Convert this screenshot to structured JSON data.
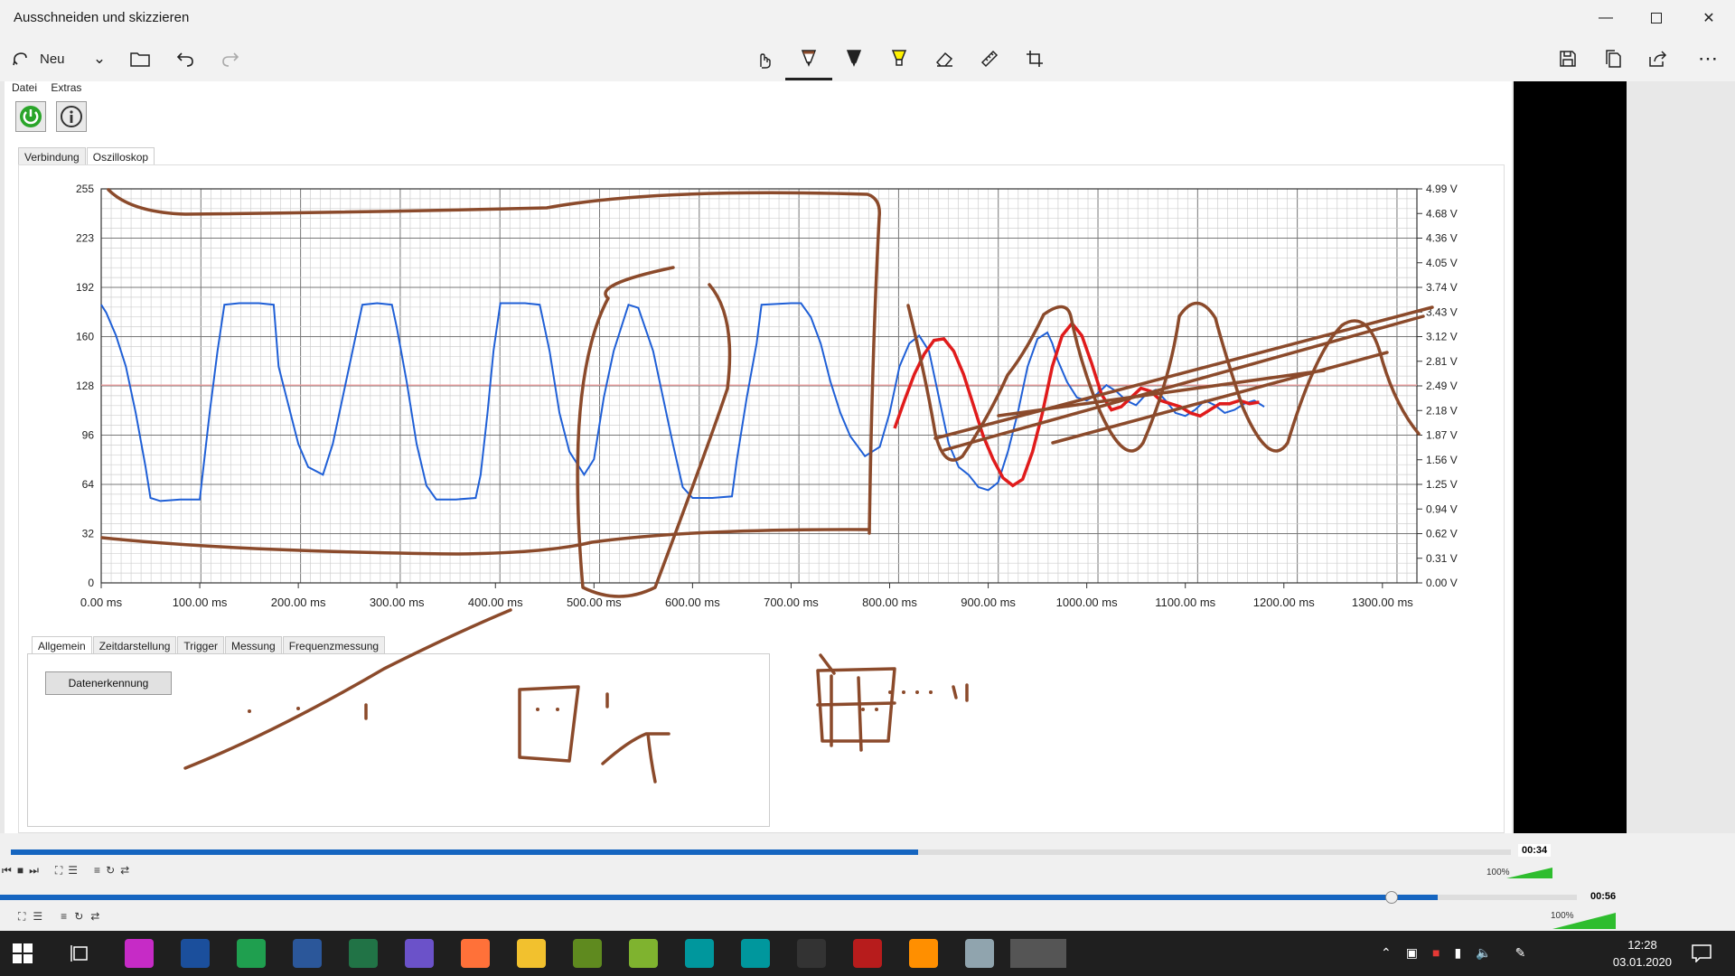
{
  "window": {
    "title": "Ausschneiden und skizzieren"
  },
  "toolbar": {
    "new_label": "Neu"
  },
  "app": {
    "menu": [
      "Datei",
      "Extras"
    ],
    "tabs": [
      "Verbindung",
      "Oszilloskop"
    ],
    "bottom_tabs": [
      "Allgemein",
      "Zeitdarstellung",
      "Trigger",
      "Messung",
      "Frequenzmessung"
    ],
    "datenerkennung_label": "Datenerkennung"
  },
  "chart_data": {
    "type": "line",
    "y_left_ticks": [
      "255",
      "223",
      "192",
      "160",
      "128",
      "96",
      "64",
      "32",
      "0"
    ],
    "y_right_ticks": [
      "4.99 V",
      "4.68 V",
      "4.36 V",
      "4.05 V",
      "3.74 V",
      "3.43 V",
      "3.12 V",
      "2.81 V",
      "2.49 V",
      "2.18 V",
      "1.87 V",
      "1.56 V",
      "1.25 V",
      "0.94 V",
      "0.62 V",
      "0.31 V",
      "0.00 V"
    ],
    "x_ticks": [
      "0.00 ms",
      "100.00 ms",
      "200.00 ms",
      "300.00 ms",
      "400.00 ms",
      "500.00 ms",
      "600.00 ms",
      "700.00 ms",
      "800.00 ms",
      "900.00 ms",
      "1000.00 ms",
      "1100.00 ms",
      "1200.00 ms",
      "1300.00 ms"
    ],
    "ylim": [
      0,
      255
    ],
    "xlim": [
      0,
      1335
    ],
    "reference_level": 128,
    "series": [
      {
        "color": "#1f5fd6",
        "points": [
          [
            0,
            180
          ],
          [
            5,
            175
          ],
          [
            15,
            160
          ],
          [
            25,
            140
          ],
          [
            35,
            110
          ],
          [
            45,
            75
          ],
          [
            50,
            55
          ],
          [
            60,
            53
          ],
          [
            80,
            54
          ],
          [
            100,
            54
          ],
          [
            102,
            65
          ],
          [
            110,
            110
          ],
          [
            118,
            150
          ],
          [
            125,
            180
          ],
          [
            140,
            181
          ],
          [
            160,
            181
          ],
          [
            175,
            180
          ],
          [
            180,
            140
          ],
          [
            190,
            115
          ],
          [
            200,
            90
          ],
          [
            210,
            75
          ],
          [
            225,
            70
          ],
          [
            235,
            90
          ],
          [
            245,
            120
          ],
          [
            255,
            150
          ],
          [
            265,
            180
          ],
          [
            280,
            181
          ],
          [
            295,
            180
          ],
          [
            300,
            165
          ],
          [
            310,
            130
          ],
          [
            320,
            90
          ],
          [
            330,
            63
          ],
          [
            340,
            54
          ],
          [
            360,
            54
          ],
          [
            380,
            55
          ],
          [
            385,
            70
          ],
          [
            392,
            110
          ],
          [
            398,
            150
          ],
          [
            405,
            181
          ],
          [
            430,
            181
          ],
          [
            445,
            180
          ],
          [
            455,
            150
          ],
          [
            465,
            110
          ],
          [
            475,
            85
          ],
          [
            490,
            70
          ],
          [
            500,
            80
          ],
          [
            510,
            120
          ],
          [
            520,
            150
          ],
          [
            535,
            180
          ],
          [
            545,
            178
          ],
          [
            560,
            150
          ],
          [
            570,
            120
          ],
          [
            580,
            90
          ],
          [
            590,
            62
          ],
          [
            600,
            55
          ],
          [
            620,
            55
          ],
          [
            640,
            56
          ],
          [
            645,
            80
          ],
          [
            655,
            120
          ],
          [
            665,
            155
          ],
          [
            670,
            180
          ],
          [
            700,
            181
          ],
          [
            710,
            181
          ],
          [
            720,
            172
          ],
          [
            730,
            155
          ],
          [
            740,
            130
          ],
          [
            750,
            110
          ],
          [
            760,
            95
          ],
          [
            775,
            82
          ],
          [
            790,
            88
          ],
          [
            800,
            110
          ],
          [
            810,
            140
          ],
          [
            820,
            155
          ],
          [
            830,
            160
          ],
          [
            840,
            150
          ],
          [
            850,
            120
          ],
          [
            860,
            90
          ],
          [
            870,
            75
          ],
          [
            880,
            70
          ],
          [
            890,
            62
          ],
          [
            900,
            60
          ],
          [
            910,
            65
          ],
          [
            920,
            85
          ],
          [
            930,
            110
          ],
          [
            940,
            140
          ],
          [
            950,
            158
          ],
          [
            960,
            162
          ],
          [
            965,
            155
          ],
          [
            970,
            145
          ],
          [
            980,
            130
          ],
          [
            990,
            120
          ],
          [
            1000,
            118
          ],
          [
            1010,
            122
          ],
          [
            1020,
            128
          ],
          [
            1030,
            124
          ],
          [
            1040,
            118
          ],
          [
            1050,
            115
          ],
          [
            1060,
            122
          ],
          [
            1070,
            125
          ],
          [
            1080,
            118
          ],
          [
            1090,
            110
          ],
          [
            1100,
            108
          ],
          [
            1110,
            112
          ],
          [
            1120,
            118
          ],
          [
            1130,
            115
          ],
          [
            1140,
            110
          ],
          [
            1150,
            112
          ],
          [
            1160,
            116
          ],
          [
            1170,
            118
          ],
          [
            1180,
            114
          ]
        ]
      },
      {
        "color": "#e01b1b",
        "points": [
          [
            805,
            100
          ],
          [
            815,
            118
          ],
          [
            825,
            135
          ],
          [
            835,
            148
          ],
          [
            845,
            157
          ],
          [
            855,
            158
          ],
          [
            865,
            150
          ],
          [
            875,
            135
          ],
          [
            885,
            115
          ],
          [
            895,
            95
          ],
          [
            905,
            80
          ],
          [
            915,
            68
          ],
          [
            925,
            63
          ],
          [
            935,
            67
          ],
          [
            945,
            85
          ],
          [
            955,
            110
          ],
          [
            965,
            140
          ],
          [
            975,
            160
          ],
          [
            985,
            168
          ],
          [
            995,
            160
          ],
          [
            1005,
            142
          ],
          [
            1015,
            122
          ],
          [
            1025,
            112
          ],
          [
            1035,
            114
          ],
          [
            1045,
            120
          ],
          [
            1055,
            126
          ],
          [
            1065,
            124
          ],
          [
            1075,
            118
          ],
          [
            1085,
            116
          ],
          [
            1095,
            114
          ],
          [
            1105,
            110
          ],
          [
            1115,
            108
          ],
          [
            1125,
            112
          ],
          [
            1135,
            116
          ],
          [
            1145,
            116
          ],
          [
            1155,
            118
          ],
          [
            1165,
            116
          ],
          [
            1175,
            117
          ]
        ]
      }
    ]
  },
  "vlc": {
    "time1": "00:34",
    "time2": "00:56",
    "volume1": "100%",
    "volume2": "100%",
    "progress1": 0.605,
    "progress2": 0.912
  },
  "taskbar": {
    "time": "12:28",
    "date": "03.01.2020",
    "apps": [
      "snip-icon",
      "paint3d-icon",
      "notepad-icon",
      "sheets-icon",
      "word-icon",
      "excel-icon",
      "settings-icon",
      "firefox-icon",
      "explorer-icon",
      "earth-icon",
      "d-app-icon",
      "arduino-icon",
      "arduino2-icon",
      "monitor-icon",
      "bug-icon",
      "vlc-icon",
      "paint-icon",
      "sketch-icon"
    ]
  }
}
